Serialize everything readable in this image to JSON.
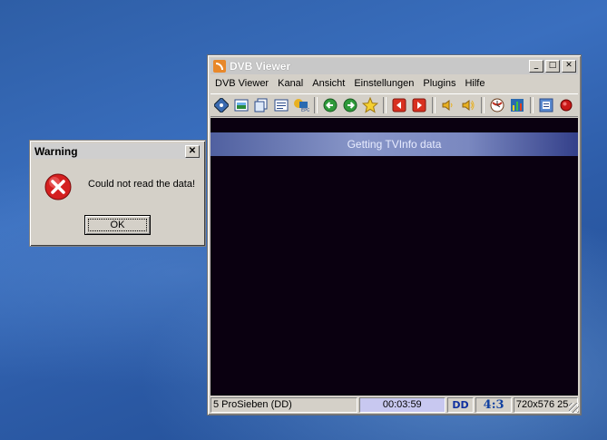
{
  "window": {
    "title": "DVB Viewer",
    "menu": [
      {
        "label": "DVB Viewer"
      },
      {
        "label": "Kanal"
      },
      {
        "label": "Ansicht"
      },
      {
        "label": "Einstellungen"
      },
      {
        "label": "Plugins"
      },
      {
        "label": "Hilfe"
      }
    ],
    "toolbar_icons": [
      "channel-icon",
      "picture-icon",
      "copy-window-icon",
      "list-icon",
      "epg-icon",
      "back-arrow-icon",
      "forward-arrow-icon",
      "favorite-star-icon",
      "previous-channel-icon",
      "next-channel-icon",
      "volume-down-icon",
      "volume-up-icon",
      "timeshift-icon",
      "equalizer-icon",
      "settings-icon",
      "record-icon"
    ],
    "osd_text": "Getting TVInfo data",
    "status": {
      "channel": "5 ProSieben (DD)",
      "time": "00:03:59",
      "dolby": "DD",
      "aspect": "4:3",
      "resolution": "720x576 25"
    }
  },
  "dialog": {
    "title": "Warning",
    "message": "Could not read the data!",
    "ok_label": "OK"
  },
  "colors": {
    "desktop": "#2e5ea6",
    "video_bg": "#0a0010",
    "osd_bar": "#7a88c0",
    "error_red": "#d42020"
  }
}
